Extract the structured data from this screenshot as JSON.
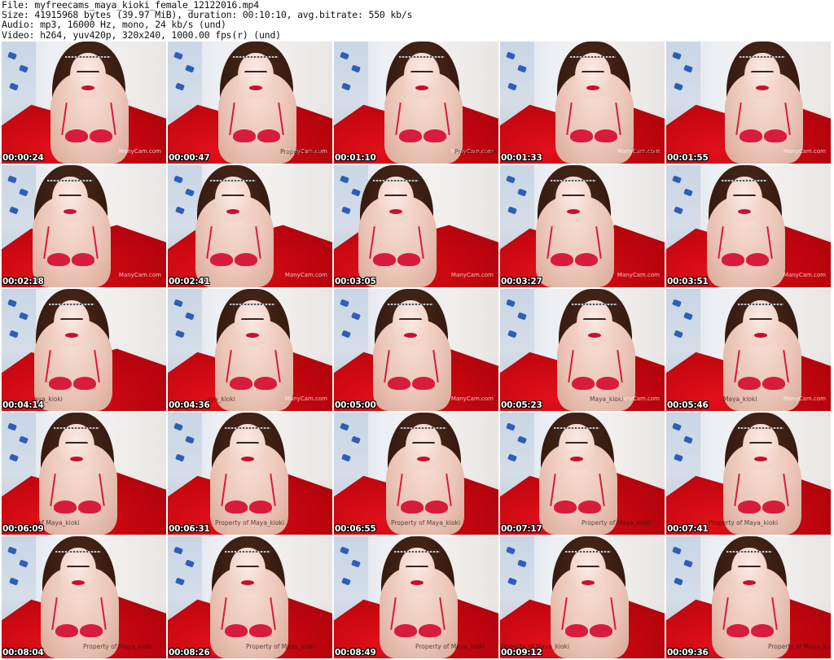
{
  "header": {
    "file_line": "File: myfreecams_maya_kioki_female_12122016.mp4",
    "size_line": "Size: 41915968 bytes (39.97 MiB), duration: 00:10:10, avg.bitrate: 550 kb/s",
    "audio_line": "Audio: mp3, 16000 Hz, mono, 24 kb/s (und)",
    "video_line": "Video: h264, yuv420p, 320x240, 1000.00 fps(r) (und)"
  },
  "thumbnails": [
    {
      "time": "00:00:24",
      "manycam": "ManyCam.com",
      "property": ""
    },
    {
      "time": "00:00:47",
      "manycam": "ManyCam.com",
      "property": "Property of M"
    },
    {
      "time": "00:01:10",
      "manycam": "ManyCam.com",
      "property": "Property of M"
    },
    {
      "time": "00:01:33",
      "manycam": "ManyCam.com",
      "property": "Propert"
    },
    {
      "time": "00:01:55",
      "manycam": "ManyCam.com",
      "property": ""
    },
    {
      "time": "00:02:18",
      "manycam": "ManyCam.com",
      "property": ""
    },
    {
      "time": "00:02:41",
      "manycam": "ManyCam.com",
      "property": ""
    },
    {
      "time": "00:03:05",
      "manycam": "ManyCam.com",
      "property": ""
    },
    {
      "time": "00:03:27",
      "manycam": "ManyCam.com",
      "property": ""
    },
    {
      "time": "00:03:51",
      "manycam": "ManyCam.com",
      "property": ""
    },
    {
      "time": "00:04:14",
      "manycam": "",
      "property": "aya_kioki"
    },
    {
      "time": "00:04:36",
      "manycam": "ManyCam.com",
      "property": "aya_kioki"
    },
    {
      "time": "00:05:00",
      "manycam": "ManyCam.com",
      "property": ""
    },
    {
      "time": "00:05:23",
      "manycam": "ManyCam.com",
      "property": "Maya_kioki"
    },
    {
      "time": "00:05:46",
      "manycam": "ManyCam.com",
      "property": "Maya_kioki"
    },
    {
      "time": "00:06:09",
      "manycam": "",
      "property": "y of Maya_kioki"
    },
    {
      "time": "00:06:31",
      "manycam": "",
      "property": "Property of Maya_kioki"
    },
    {
      "time": "00:06:55",
      "manycam": "",
      "property": "Property of Maya_kioki"
    },
    {
      "time": "00:07:17",
      "manycam": "",
      "property": "Property of Maya_kioki"
    },
    {
      "time": "00:07:41",
      "manycam": "",
      "property": "Property of Maya_kioki"
    },
    {
      "time": "00:08:04",
      "manycam": "",
      "property": "Property of Maya_kioki"
    },
    {
      "time": "00:08:26",
      "manycam": "",
      "property": "Property of Maya_kioki"
    },
    {
      "time": "00:08:49",
      "manycam": "",
      "property": "Property of Maya_kioki"
    },
    {
      "time": "00:09:12",
      "manycam": "",
      "property": "Property of Maya_kioki"
    },
    {
      "time": "00:09:36",
      "manycam": "",
      "property": "Property of Maya_kioki"
    }
  ]
}
